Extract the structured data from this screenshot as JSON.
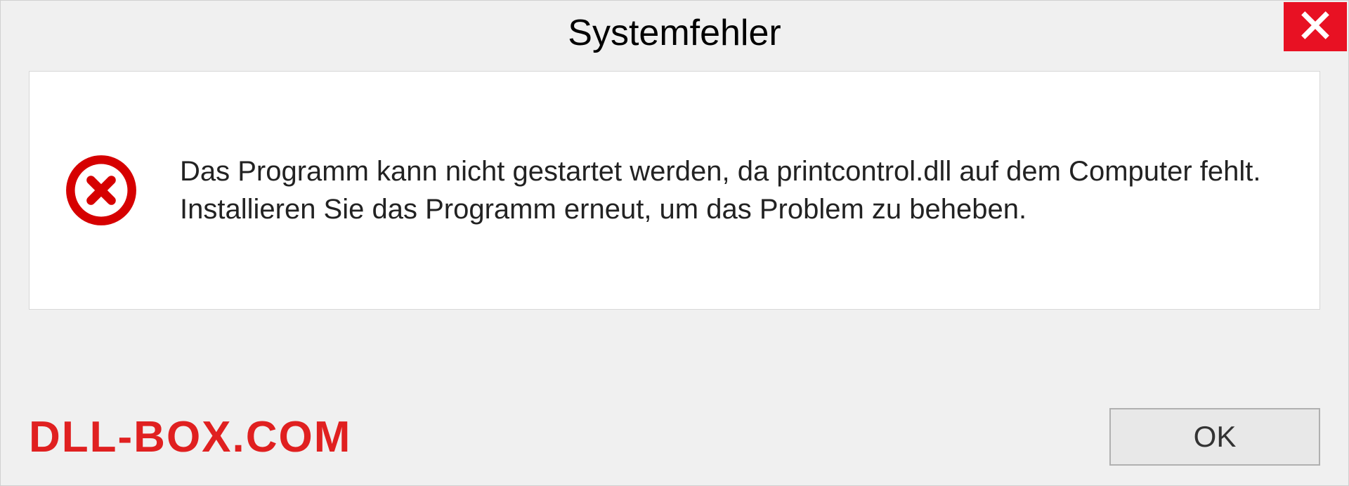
{
  "dialog": {
    "title": "Systemfehler",
    "message": "Das Programm kann nicht gestartet werden, da printcontrol.dll auf dem Computer fehlt. Installieren Sie das Programm erneut, um das Problem zu beheben.",
    "ok_label": "OK"
  },
  "watermark": "DLL-BOX.COM",
  "colors": {
    "close_bg": "#e81123",
    "error_icon": "#d60000",
    "watermark": "#e02020"
  }
}
